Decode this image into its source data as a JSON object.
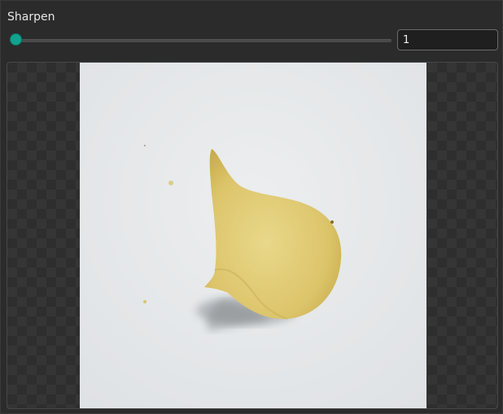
{
  "filter": {
    "title": "Sharpen",
    "value": "1",
    "slider_fraction": 0.0
  },
  "preview": {
    "subject": "potato-chip-photo"
  },
  "colors": {
    "accent": "#12a38e",
    "background": "#2b2b2b"
  }
}
